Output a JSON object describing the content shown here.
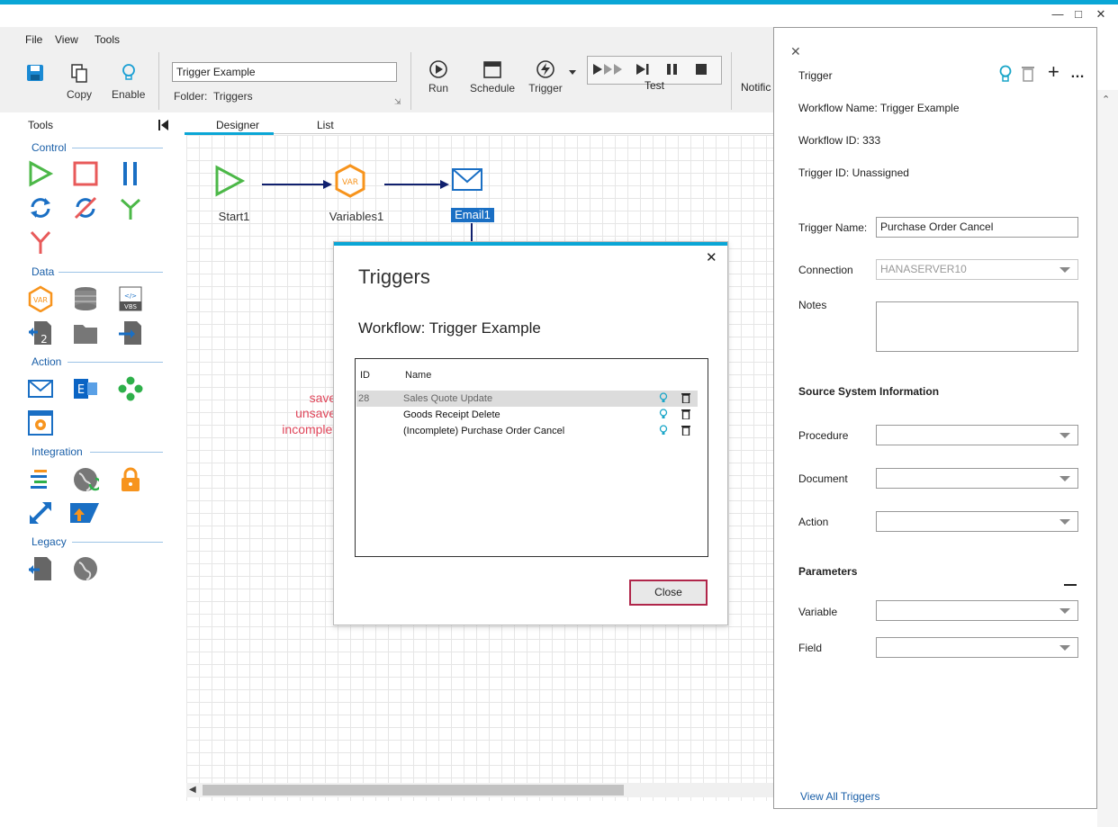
{
  "menu": {
    "file": "File",
    "view": "View",
    "tools": "Tools"
  },
  "toolbar": {
    "copy_label": "Copy",
    "enable_label": "Enable",
    "workflow_name": "Trigger Example",
    "folder_label": "Folder:",
    "folder_value": "Triggers",
    "run_label": "Run",
    "schedule_label": "Schedule",
    "trigger_label": "Trigger",
    "test_label": "Test",
    "notifications_label": "Notific"
  },
  "tools": {
    "title": "Tools",
    "groups": [
      "Control",
      "Data",
      "Action",
      "Integration",
      "Legacy"
    ]
  },
  "tabs": {
    "designer": "Designer",
    "list": "List"
  },
  "nodes": {
    "start": "Start1",
    "variables": "Variables1",
    "email": "Email1",
    "var_text": "VAR"
  },
  "legend": {
    "saved": "saved",
    "unsaved": "unsaved",
    "incomplete": "incomplete"
  },
  "dialog": {
    "title": "Triggers",
    "workflow": "Workflow: Trigger Example",
    "col_id": "ID",
    "col_name": "Name",
    "rows": [
      {
        "id": "28",
        "name": "Sales Quote Update"
      },
      {
        "id": "",
        "name": "Goods Receipt Delete"
      },
      {
        "id": "",
        "name": "(Incomplete) Purchase Order Cancel"
      }
    ],
    "close_label": "Close"
  },
  "panel": {
    "title": "Trigger",
    "workflow_name": "Workflow Name: Trigger Example",
    "workflow_id": "Workflow ID: 333",
    "trigger_id": "Trigger ID: Unassigned",
    "trigger_name_label": "Trigger Name:",
    "trigger_name_value": "Purchase Order Cancel",
    "connection_label": "Connection",
    "connection_value": "HANASERVER10",
    "notes_label": "Notes",
    "source_heading": "Source System Information",
    "procedure_label": "Procedure",
    "document_label": "Document",
    "action_label": "Action",
    "parameters_heading": "Parameters",
    "variable_label": "Variable",
    "field_label": "Field",
    "view_all": "View All Triggers"
  },
  "colors": {
    "accent": "#0aa6d6",
    "start_green": "#4cb848",
    "var_orange": "#f7941d",
    "email_blue": "#1a6fc4",
    "legend_red": "#e0475b",
    "close_border": "#b0264a"
  }
}
